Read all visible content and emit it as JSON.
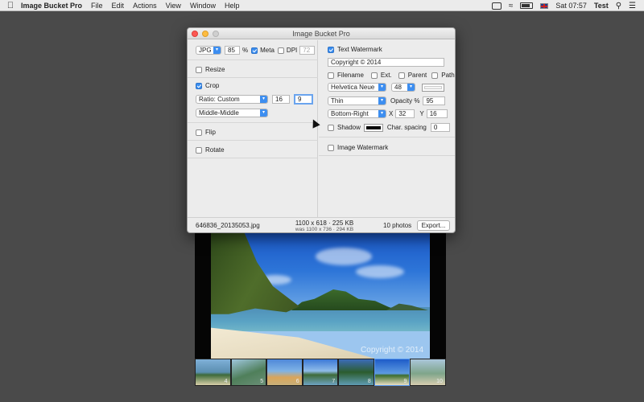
{
  "menubar": {
    "app_name": "Image Bucket Pro",
    "menus": [
      "File",
      "Edit",
      "Actions",
      "View",
      "Window",
      "Help"
    ],
    "clock": "Sat 07:57",
    "user": "Test"
  },
  "window": {
    "title": "Image Bucket Pro"
  },
  "left": {
    "format": "JPG",
    "quality": "85",
    "quality_unit": "%",
    "meta_label": "Meta",
    "meta_checked": true,
    "dpi_label": "DPI",
    "dpi_value": "72",
    "resize_label": "Resize",
    "crop_label": "Crop",
    "crop_ratio": "Ratio: Custom",
    "crop_w": "16",
    "crop_h": "9",
    "crop_anchor": "Middle-Middle",
    "flip_label": "Flip",
    "rotate_label": "Rotate"
  },
  "right": {
    "text_watermark_label": "Text Watermark",
    "watermark_text": "Copyright © 2014",
    "filename_label": "Filename",
    "ext_label": "Ext.",
    "parent_label": "Parent",
    "path_label": "Path",
    "font": "Helvetica Neue",
    "font_size": "48",
    "weight": "Thin",
    "opacity_label": "Opacity %",
    "opacity": "95",
    "position": "Bottom-Right",
    "x_label": "X",
    "x_value": "32",
    "y_label": "Y",
    "y_value": "16",
    "shadow_label": "Shadow",
    "char_spacing_label": "Char. spacing",
    "char_spacing": "0",
    "image_watermark_label": "Image Watermark"
  },
  "status": {
    "filename": "646836_20135053.jpg",
    "dimensions": "1100 x 618 · 225 KB",
    "original": "was 1100 x 736 · 294 KB",
    "count": "10 photos",
    "export_label": "Export..."
  },
  "preview": {
    "watermark": "Copyright © 2014"
  },
  "filmstrip": [
    "4",
    "5",
    "6",
    "7",
    "8",
    "9",
    "10"
  ]
}
